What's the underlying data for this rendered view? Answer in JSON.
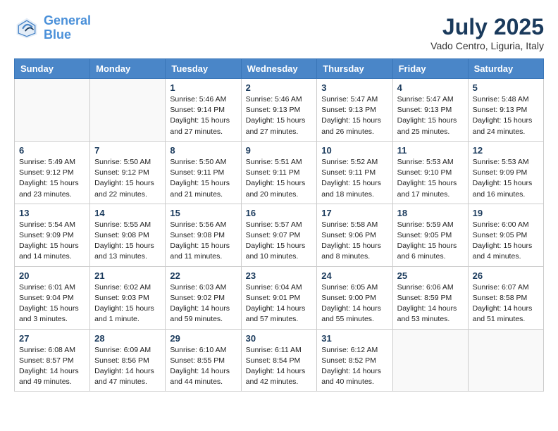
{
  "header": {
    "logo_line1": "General",
    "logo_line2": "Blue",
    "month_year": "July 2025",
    "location": "Vado Centro, Liguria, Italy"
  },
  "weekdays": [
    "Sunday",
    "Monday",
    "Tuesday",
    "Wednesday",
    "Thursday",
    "Friday",
    "Saturday"
  ],
  "weeks": [
    [
      {
        "day": "",
        "info": ""
      },
      {
        "day": "",
        "info": ""
      },
      {
        "day": "1",
        "info": "Sunrise: 5:46 AM\nSunset: 9:14 PM\nDaylight: 15 hours\nand 27 minutes."
      },
      {
        "day": "2",
        "info": "Sunrise: 5:46 AM\nSunset: 9:13 PM\nDaylight: 15 hours\nand 27 minutes."
      },
      {
        "day": "3",
        "info": "Sunrise: 5:47 AM\nSunset: 9:13 PM\nDaylight: 15 hours\nand 26 minutes."
      },
      {
        "day": "4",
        "info": "Sunrise: 5:47 AM\nSunset: 9:13 PM\nDaylight: 15 hours\nand 25 minutes."
      },
      {
        "day": "5",
        "info": "Sunrise: 5:48 AM\nSunset: 9:13 PM\nDaylight: 15 hours\nand 24 minutes."
      }
    ],
    [
      {
        "day": "6",
        "info": "Sunrise: 5:49 AM\nSunset: 9:12 PM\nDaylight: 15 hours\nand 23 minutes."
      },
      {
        "day": "7",
        "info": "Sunrise: 5:50 AM\nSunset: 9:12 PM\nDaylight: 15 hours\nand 22 minutes."
      },
      {
        "day": "8",
        "info": "Sunrise: 5:50 AM\nSunset: 9:11 PM\nDaylight: 15 hours\nand 21 minutes."
      },
      {
        "day": "9",
        "info": "Sunrise: 5:51 AM\nSunset: 9:11 PM\nDaylight: 15 hours\nand 20 minutes."
      },
      {
        "day": "10",
        "info": "Sunrise: 5:52 AM\nSunset: 9:11 PM\nDaylight: 15 hours\nand 18 minutes."
      },
      {
        "day": "11",
        "info": "Sunrise: 5:53 AM\nSunset: 9:10 PM\nDaylight: 15 hours\nand 17 minutes."
      },
      {
        "day": "12",
        "info": "Sunrise: 5:53 AM\nSunset: 9:09 PM\nDaylight: 15 hours\nand 16 minutes."
      }
    ],
    [
      {
        "day": "13",
        "info": "Sunrise: 5:54 AM\nSunset: 9:09 PM\nDaylight: 15 hours\nand 14 minutes."
      },
      {
        "day": "14",
        "info": "Sunrise: 5:55 AM\nSunset: 9:08 PM\nDaylight: 15 hours\nand 13 minutes."
      },
      {
        "day": "15",
        "info": "Sunrise: 5:56 AM\nSunset: 9:08 PM\nDaylight: 15 hours\nand 11 minutes."
      },
      {
        "day": "16",
        "info": "Sunrise: 5:57 AM\nSunset: 9:07 PM\nDaylight: 15 hours\nand 10 minutes."
      },
      {
        "day": "17",
        "info": "Sunrise: 5:58 AM\nSunset: 9:06 PM\nDaylight: 15 hours\nand 8 minutes."
      },
      {
        "day": "18",
        "info": "Sunrise: 5:59 AM\nSunset: 9:05 PM\nDaylight: 15 hours\nand 6 minutes."
      },
      {
        "day": "19",
        "info": "Sunrise: 6:00 AM\nSunset: 9:05 PM\nDaylight: 15 hours\nand 4 minutes."
      }
    ],
    [
      {
        "day": "20",
        "info": "Sunrise: 6:01 AM\nSunset: 9:04 PM\nDaylight: 15 hours\nand 3 minutes."
      },
      {
        "day": "21",
        "info": "Sunrise: 6:02 AM\nSunset: 9:03 PM\nDaylight: 15 hours\nand 1 minute."
      },
      {
        "day": "22",
        "info": "Sunrise: 6:03 AM\nSunset: 9:02 PM\nDaylight: 14 hours\nand 59 minutes."
      },
      {
        "day": "23",
        "info": "Sunrise: 6:04 AM\nSunset: 9:01 PM\nDaylight: 14 hours\nand 57 minutes."
      },
      {
        "day": "24",
        "info": "Sunrise: 6:05 AM\nSunset: 9:00 PM\nDaylight: 14 hours\nand 55 minutes."
      },
      {
        "day": "25",
        "info": "Sunrise: 6:06 AM\nSunset: 8:59 PM\nDaylight: 14 hours\nand 53 minutes."
      },
      {
        "day": "26",
        "info": "Sunrise: 6:07 AM\nSunset: 8:58 PM\nDaylight: 14 hours\nand 51 minutes."
      }
    ],
    [
      {
        "day": "27",
        "info": "Sunrise: 6:08 AM\nSunset: 8:57 PM\nDaylight: 14 hours\nand 49 minutes."
      },
      {
        "day": "28",
        "info": "Sunrise: 6:09 AM\nSunset: 8:56 PM\nDaylight: 14 hours\nand 47 minutes."
      },
      {
        "day": "29",
        "info": "Sunrise: 6:10 AM\nSunset: 8:55 PM\nDaylight: 14 hours\nand 44 minutes."
      },
      {
        "day": "30",
        "info": "Sunrise: 6:11 AM\nSunset: 8:54 PM\nDaylight: 14 hours\nand 42 minutes."
      },
      {
        "day": "31",
        "info": "Sunrise: 6:12 AM\nSunset: 8:52 PM\nDaylight: 14 hours\nand 40 minutes."
      },
      {
        "day": "",
        "info": ""
      },
      {
        "day": "",
        "info": ""
      }
    ]
  ]
}
